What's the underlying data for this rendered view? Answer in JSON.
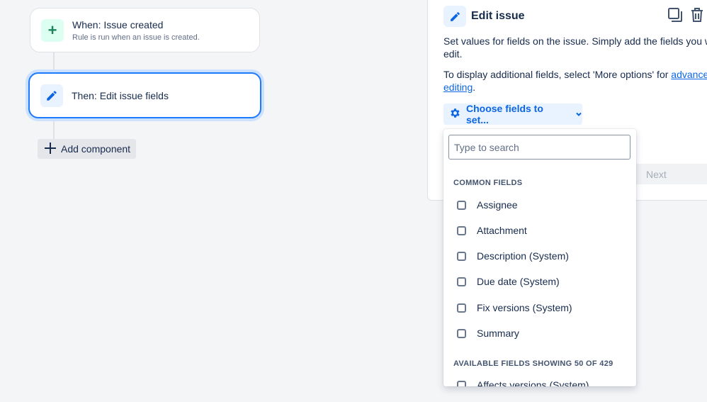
{
  "flow": {
    "trigger": {
      "title": "When: Issue created",
      "subtitle": "Rule is run when an issue is created.",
      "icon": "plus-icon"
    },
    "action": {
      "title": "Then: Edit issue fields",
      "icon": "pencil-icon"
    },
    "add_component_label": "Add component"
  },
  "panel": {
    "title": "Edit issue",
    "icon": "pencil-icon",
    "desc1_line1": "Set values for fields on the issue. Simply add the fields you want",
    "desc1_line2": "edit.",
    "desc2_prefix": "To display additional fields, select 'More options' for ",
    "desc2_link_part1": "advanced f",
    "desc2_link_part2": "editing",
    "desc2_suffix": ".",
    "choose_fields_label": "Choose fields to set...",
    "next_label": "Next",
    "actions": [
      "duplicate-icon",
      "trash-icon"
    ]
  },
  "dropdown": {
    "search_placeholder": "Type to search",
    "search_value": "",
    "common_header": "COMMON FIELDS",
    "common_fields": [
      "Assignee",
      "Attachment",
      "Description (System)",
      "Due date (System)",
      "Fix versions (System)",
      "Summary"
    ],
    "available_header": "AVAILABLE FIELDS SHOWING 50 OF 429",
    "available_fields": [
      "Affects versions (System)"
    ]
  },
  "colors": {
    "accent": "#0c66e4",
    "selected_border": "#1d7afc",
    "trigger_icon_bg": "#dcfff1",
    "action_icon_bg": "#e9f2ff"
  }
}
